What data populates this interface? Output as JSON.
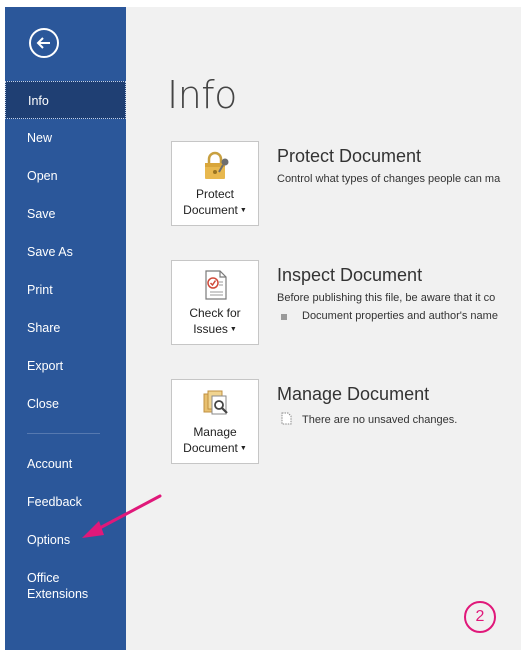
{
  "sidebar": {
    "items": [
      {
        "label": "Info"
      },
      {
        "label": "New"
      },
      {
        "label": "Open"
      },
      {
        "label": "Save"
      },
      {
        "label": "Save As"
      },
      {
        "label": "Print"
      },
      {
        "label": "Share"
      },
      {
        "label": "Export"
      },
      {
        "label": "Close"
      },
      {
        "label": "Account"
      },
      {
        "label": "Feedback"
      },
      {
        "label": "Options"
      },
      {
        "label": "Office\nExtensions"
      }
    ]
  },
  "main": {
    "title": "Info",
    "sections": [
      {
        "tile_line1": "Protect",
        "tile_line2": "Document",
        "icon": "lock-key-icon",
        "title": "Protect Document",
        "description": "Control what types of changes people can ma"
      },
      {
        "tile_line1": "Check for",
        "tile_line2": "Issues",
        "icon": "checklist-icon",
        "title": "Inspect Document",
        "description": "Before publishing this file, be aware that it co",
        "bullet": "Document properties and author's name"
      },
      {
        "tile_line1": "Manage",
        "tile_line2": "Document",
        "icon": "manage-document-icon",
        "title": "Manage Document",
        "description": "There are no unsaved changes."
      }
    ]
  },
  "annotation": {
    "step_number": "2",
    "color": "#e0187a"
  },
  "colors": {
    "sidebar_bg": "#2b579a",
    "sidebar_active": "#1f3f73",
    "content_bg": "#f1f1f1"
  }
}
